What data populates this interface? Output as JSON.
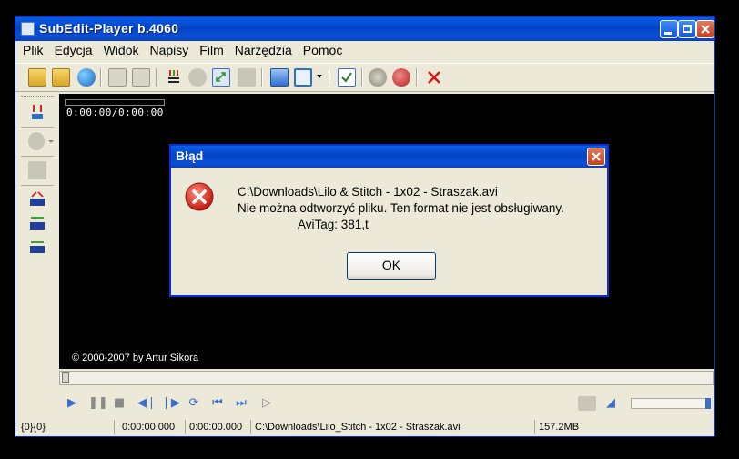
{
  "window": {
    "title": "SubEdit-Player  b.4060"
  },
  "menu": [
    "Plik",
    "Edycja",
    "Widok",
    "Napisy",
    "Film",
    "Narzędzia",
    "Pomoc"
  ],
  "video": {
    "timecode": "0:00:00/0:00:00",
    "copyright": "© 2000-2007 by Artur Sikora"
  },
  "status": {
    "frames": "{0}{0}",
    "time1": "0:00:00.000",
    "time2": "0:00:00.000",
    "file": "C:\\Downloads\\Lilo_Stitch - 1x02 - Straszak.avi",
    "size": "157.2MB"
  },
  "dialog": {
    "title": "Błąd",
    "line1": "C:\\Downloads\\Lilo & Stitch - 1x02 - Straszak.avi",
    "line2": "Nie można odtworzyć pliku. Ten format nie jest obsługiwany.",
    "line3": "AviTag: 381,t",
    "ok_label": "OK"
  },
  "volume": {
    "level": 1.0
  }
}
